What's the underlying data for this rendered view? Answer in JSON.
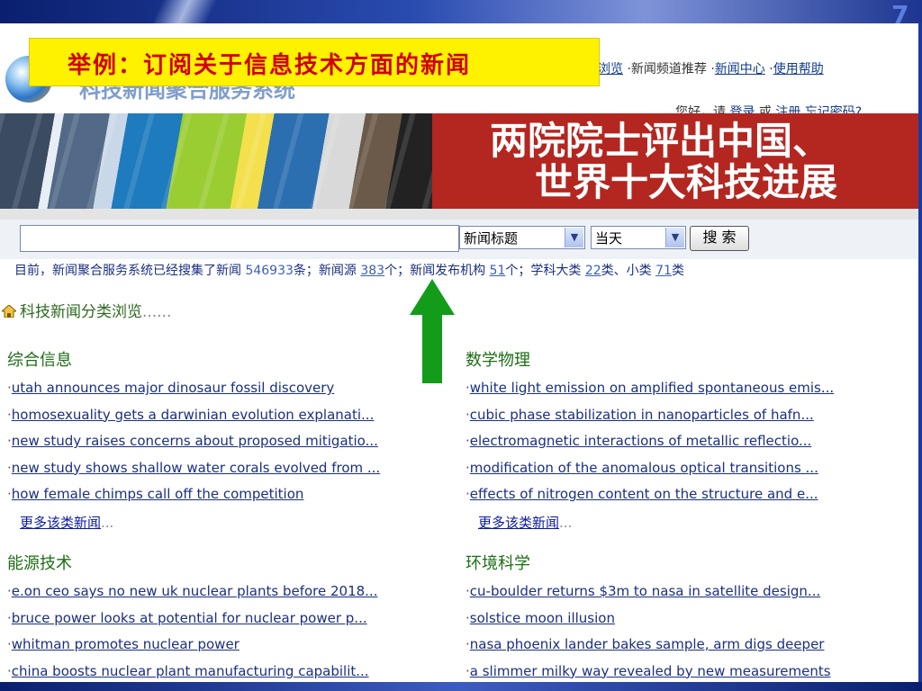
{
  "slide": {
    "callout_text": "举例：订阅关于信息技术方面的新闻",
    "slide_number": "7"
  },
  "header": {
    "top_nav": {
      "browse_fragment": "浏览",
      "channel_recommend": "·新闻频道推荐",
      "news_center": "新闻中心",
      "help": "使用帮助",
      "sep": "·"
    },
    "login": {
      "greeting": "您好，请",
      "login_link": "登录",
      "or": "或",
      "register_link": "注册",
      "forgot_link": "忘记密码?"
    }
  },
  "banner": {
    "line1": "两院院士评出中国、",
    "line2": "世界十大科技进展"
  },
  "search": {
    "input_value": "",
    "field_select": "新闻标题",
    "time_select": "当天",
    "button_label": "搜 索"
  },
  "stats": {
    "prefix": "目前，新闻聚合服务系统已经搜集了新闻",
    "news_count": "546933",
    "unit1": "条；新闻源",
    "source_count": "383",
    "unit2": "个；新闻发布机构",
    "publisher_count": "51",
    "unit3": "个；学科大类",
    "major_count": "22",
    "unit4": "类、小类",
    "minor_count": "71",
    "unit5": "类"
  },
  "category_browse": {
    "label": "科技新闻分类浏览",
    "ellipsis": "......"
  },
  "sections": [
    {
      "title": "综合信息",
      "items": [
        "utah announces major dinosaur fossil discovery",
        "homosexuality gets a darwinian evolution explanati...",
        "new study raises concerns about proposed mitigatio...",
        "new study shows shallow water corals evolved from ...",
        "how female chimps call off the competition"
      ],
      "more": "更多该类新闻",
      "more_suffix": "..."
    },
    {
      "title": "数学物理",
      "items": [
        "white light emission on amplified spontaneous emis...",
        "cubic phase stabilization in nanoparticles of hafn...",
        "electromagnetic interactions of metallic reflectio...",
        "modification of the anomalous optical transitions ...",
        "effects of nitrogen content on the structure and e..."
      ],
      "more": "更多该类新闻",
      "more_suffix": "..."
    },
    {
      "title": "能源技术",
      "items": [
        "e.on ceo says no new uk nuclear plants before 2018...",
        "bruce power looks at potential for nuclear power p...",
        "whitman promotes nuclear power",
        "china boosts nuclear plant manufacturing capabilit..."
      ]
    },
    {
      "title": "环境科学",
      "items": [
        "cu-boulder returns $3m to nasa in satellite design...",
        "solstice moon illusion",
        "nasa phoenix lander bakes sample, arm digs deeper",
        "a slimmer milky way revealed by new measurements"
      ]
    }
  ],
  "colors": {
    "callout_bg": "#fff200",
    "callout_text": "#d00000",
    "banner_bg": "#b42620",
    "arrow": "#129c1a",
    "link": "#1a2f80",
    "section_title": "#1e6e16"
  }
}
